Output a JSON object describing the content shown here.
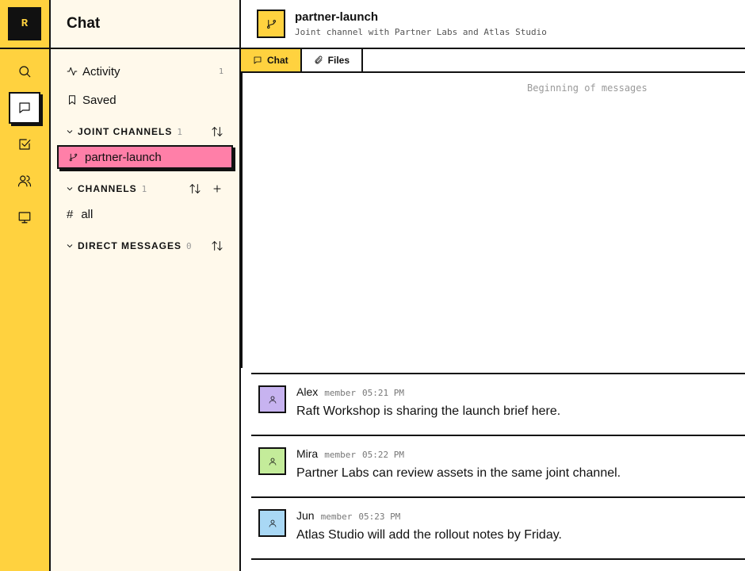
{
  "rail": {
    "logo": "R",
    "items": [
      {
        "icon": "search-icon",
        "active": false
      },
      {
        "icon": "chat-icon",
        "active": true
      },
      {
        "icon": "tasks-icon",
        "active": false
      },
      {
        "icon": "people-icon",
        "active": false
      },
      {
        "icon": "monitor-icon",
        "active": false
      }
    ]
  },
  "sidebar": {
    "title": "Chat",
    "activity": {
      "label": "Activity",
      "count": "1"
    },
    "saved": {
      "label": "Saved"
    },
    "joint_channels": {
      "label": "JOINT CHANNELS",
      "count": "1",
      "items": [
        "partner-launch"
      ]
    },
    "channels": {
      "label": "CHANNELS",
      "count": "1",
      "items": [
        "all"
      ]
    },
    "direct_messages": {
      "label": "DIRECT MESSAGES",
      "count": "0"
    }
  },
  "channel": {
    "name": "partner-launch",
    "description": "Joint channel with Partner Labs and Atlas Studio"
  },
  "tabs": [
    {
      "label": "Chat",
      "active": true
    },
    {
      "label": "Files",
      "active": false
    }
  ],
  "beginning_text": "Beginning of messages",
  "messages": [
    {
      "author": "Alex",
      "role": "member",
      "time": "05:21 PM",
      "text": "Raft Workshop is sharing the launch brief here.",
      "avatar_color": "#c7b3f0"
    },
    {
      "author": "Mira",
      "role": "member",
      "time": "05:22 PM",
      "text": "Partner Labs can review assets in the same joint channel.",
      "avatar_color": "#c4ec9a"
    },
    {
      "author": "Jun",
      "role": "member",
      "time": "05:23 PM",
      "text": "Atlas Studio will add the rollout notes by Friday.",
      "avatar_color": "#a9d8f5"
    }
  ],
  "colors": {
    "accent": "#ffd23f",
    "active_channel": "#ff7fa8",
    "sidebar_bg": "#fff9eb"
  }
}
